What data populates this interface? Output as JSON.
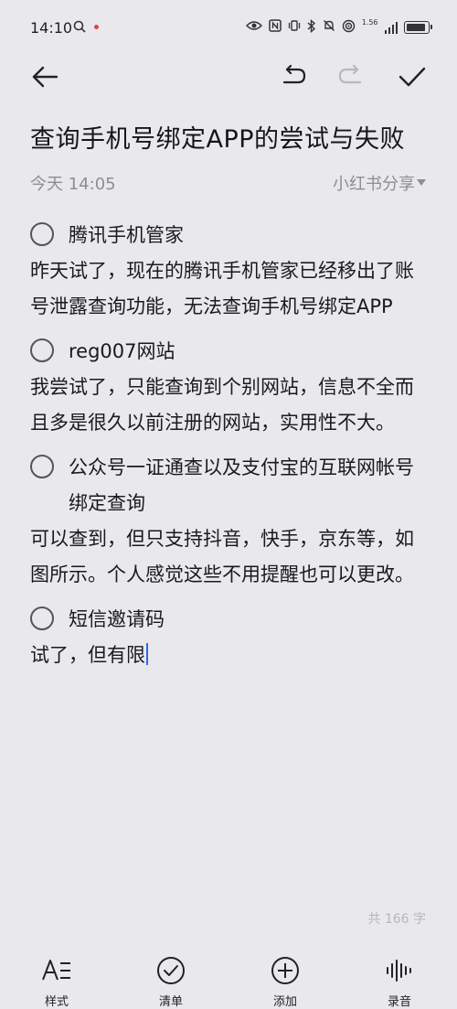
{
  "status_bar": {
    "time": "14:10",
    "notif_icon": "search-icon",
    "network_speed": "1.56",
    "icons": [
      "eye-icon",
      "nfc-icon",
      "vibrate-icon",
      "bluetooth-icon",
      "mute-icon",
      "hotspot-icon",
      "signal-icon",
      "battery-icon"
    ]
  },
  "toolbar": {
    "back": "back-arrow-icon",
    "undo": "undo-icon",
    "redo": "redo-icon",
    "done": "check-icon"
  },
  "note": {
    "title": "查询手机号绑定APP的尝试与失败",
    "date": "今天 14:05",
    "share_label": "小红书分享",
    "items": [
      {
        "checklist": "腾讯手机管家",
        "text": "昨天试了，现在的腾讯手机管家已经移出了账号泄露查询功能，无法查询手机号绑定APP"
      },
      {
        "checklist": "reg007网站",
        "text": "我尝试了，只能查询到个别网站，信息不全而且多是很久以前注册的网站，实用性不大。"
      },
      {
        "checklist": "公众号一证通查以及支付宝的互联网帐号绑定查询",
        "text": "可以查到，但只支持抖音，快手，京东等，如图所示。个人感觉这些不用提醒也可以更改。"
      },
      {
        "checklist": "短信邀请码",
        "text": "试了，但有限"
      }
    ],
    "word_count": "共 166 字"
  },
  "bottom_bar": {
    "style_label": "样式",
    "checklist_label": "清单",
    "add_label": "添加",
    "record_label": "录音"
  },
  "colors": {
    "background": "#e9e8ed",
    "text": "#1a1a1a",
    "muted": "#8d8d92",
    "cursor": "#2a6ce8"
  }
}
